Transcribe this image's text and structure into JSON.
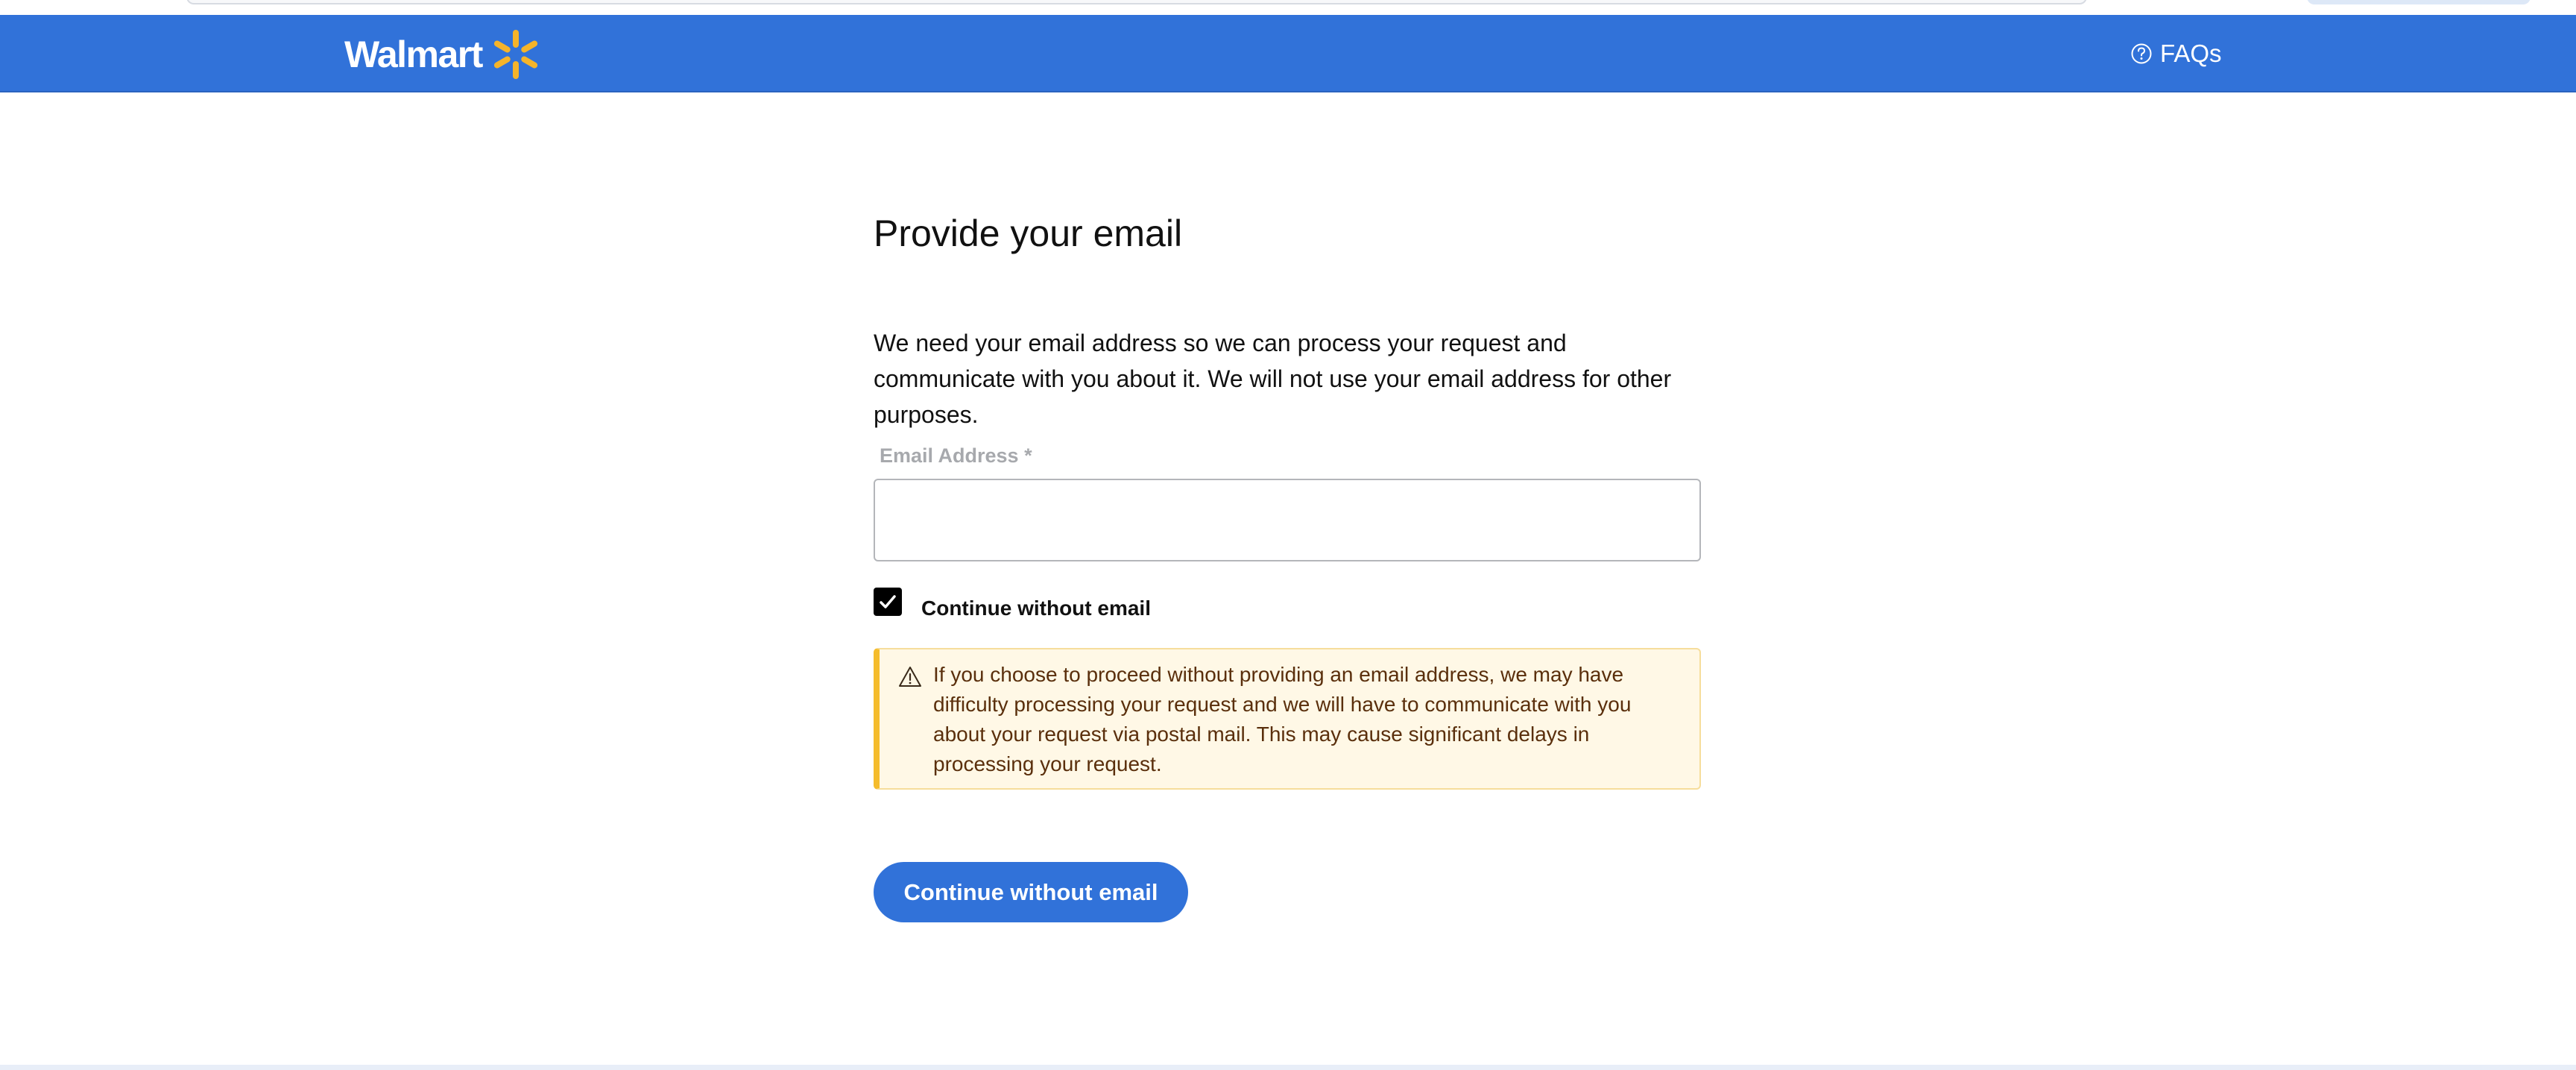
{
  "header": {
    "brand": "Walmart",
    "faq_label": "FAQs",
    "colors": {
      "bar": "#3172d9",
      "spark": "#f5b42a"
    }
  },
  "main": {
    "title": "Provide your email",
    "description": "We need your email address so we can process your request and communicate with you about it. We will not use your email address for other purposes.",
    "email_label": "Email Address *",
    "email_value": "",
    "email_placeholder": "",
    "checkbox_label": "Continue without email",
    "checkbox_checked": true,
    "warning_text": "If you choose to proceed without providing an email address, we may have difficulty processing your request and we will have to communicate with you about your request via postal mail. This may cause significant delays in processing your request.",
    "submit_label": "Continue without email"
  },
  "icons": {
    "logo": "spark-icon",
    "faq": "help-circle-icon",
    "checkbox": "checkmark-icon",
    "alert": "warning-triangle-icon"
  }
}
